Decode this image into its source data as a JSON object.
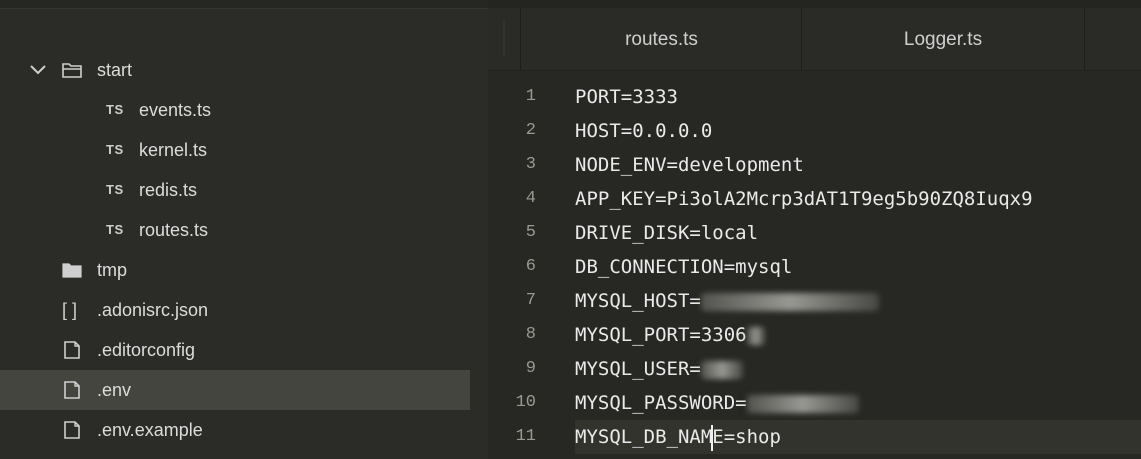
{
  "sidebar": {
    "items": [
      {
        "label": "start",
        "kind": "folder",
        "expanded": true,
        "depth": 0
      },
      {
        "label": "events.ts",
        "kind": "ts",
        "depth": 1
      },
      {
        "label": "kernel.ts",
        "kind": "ts",
        "depth": 1
      },
      {
        "label": "redis.ts",
        "kind": "ts",
        "depth": 1
      },
      {
        "label": "routes.ts",
        "kind": "ts",
        "depth": 1
      },
      {
        "label": "tmp",
        "kind": "folder",
        "expanded": false,
        "depth": 0
      },
      {
        "label": ".adonisrc.json",
        "kind": "json",
        "depth": 0
      },
      {
        "label": ".editorconfig",
        "kind": "file",
        "depth": 0
      },
      {
        "label": ".env",
        "kind": "file",
        "depth": 0,
        "selected": true
      },
      {
        "label": ".env.example",
        "kind": "file",
        "depth": 0
      }
    ],
    "ts_badge": "TS",
    "json_badge": "[ ]"
  },
  "tabs": [
    {
      "label": "routes.ts"
    },
    {
      "label": "Logger.ts"
    }
  ],
  "editor": {
    "lines": [
      {
        "num": "1",
        "text": "PORT=3333"
      },
      {
        "num": "2",
        "text": "HOST=0.0.0.0"
      },
      {
        "num": "3",
        "text": "NODE_ENV=development"
      },
      {
        "num": "4",
        "text": "APP_KEY=Pi3olA2Mcrp3dAT1T9eg5b90ZQ8Iuqx9"
      },
      {
        "num": "5",
        "text": "DRIVE_DISK=local"
      },
      {
        "num": "6",
        "text": "DB_CONNECTION=mysql"
      },
      {
        "num": "7",
        "text": "MYSQL_HOST=",
        "redacted": true
      },
      {
        "num": "8",
        "text": "MYSQL_PORT=3306",
        "redacted": true
      },
      {
        "num": "9",
        "text": "MYSQL_USER=",
        "redacted": true
      },
      {
        "num": "10",
        "text": "MYSQL_PASSWORD=",
        "redacted": true
      },
      {
        "num": "11",
        "text_before": "MYSQL_DB_NAM",
        "text_after": "E=shop",
        "current": true
      }
    ]
  },
  "colors": {
    "sidebar_bg": "#2b2b27",
    "selected_row": "#45453f",
    "editor_bg": "#272723",
    "text": "#eaeaea",
    "line_number": "#9a9a92"
  }
}
